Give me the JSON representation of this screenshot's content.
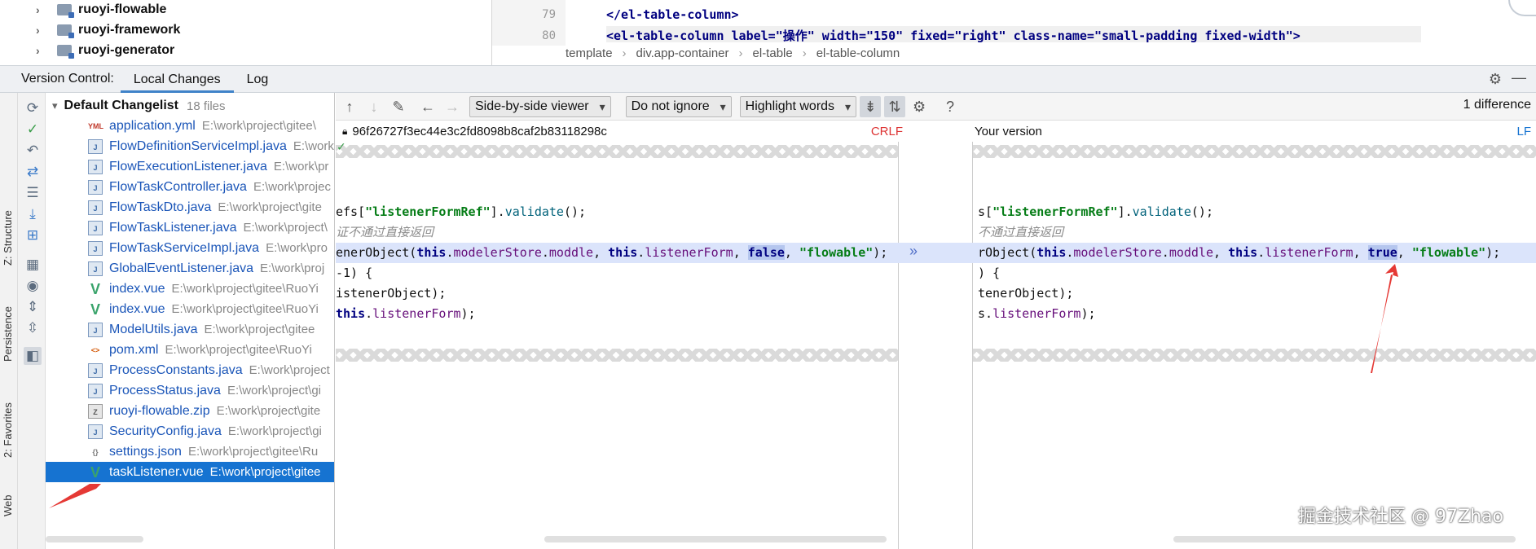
{
  "project_tree": {
    "items": [
      "ruoyi-flowable",
      "ruoyi-framework",
      "ruoyi-generator"
    ]
  },
  "top_editor": {
    "line_numbers": [
      "79",
      "80"
    ],
    "line79": "</el-table-column>",
    "line80": "<el-table-column label=\"操作\" width=\"150\" fixed=\"right\" class-name=\"small-padding fixed-width\">",
    "breadcrumbs": [
      "template",
      "div.app-container",
      "el-table",
      "el-table-column"
    ]
  },
  "vc_bar": {
    "title": "Version Control:",
    "tabs": [
      "Local Changes",
      "Log"
    ]
  },
  "side_labels": [
    "Z: Structure",
    "Persistence",
    "2: Favorites",
    "Web"
  ],
  "changelist": {
    "name": "Default Changelist",
    "count": "18 files",
    "files": [
      {
        "name": "application.yml",
        "path": "E:\\work\\project\\gitee\\",
        "icon": "yml"
      },
      {
        "name": "FlowDefinitionServiceImpl.java",
        "path": "E:\\work\\",
        "icon": "java"
      },
      {
        "name": "FlowExecutionListener.java",
        "path": "E:\\work\\pr",
        "icon": "java"
      },
      {
        "name": "FlowTaskController.java",
        "path": "E:\\work\\projec",
        "icon": "java"
      },
      {
        "name": "FlowTaskDto.java",
        "path": "E:\\work\\project\\gite",
        "icon": "java"
      },
      {
        "name": "FlowTaskListener.java",
        "path": "E:\\work\\project\\",
        "icon": "java"
      },
      {
        "name": "FlowTaskServiceImpl.java",
        "path": "E:\\work\\pro",
        "icon": "java"
      },
      {
        "name": "GlobalEventListener.java",
        "path": "E:\\work\\proj",
        "icon": "java"
      },
      {
        "name": "index.vue",
        "path": "E:\\work\\project\\gitee\\RuoYi",
        "icon": "vue"
      },
      {
        "name": "index.vue",
        "path": "E:\\work\\project\\gitee\\RuoYi",
        "icon": "vue"
      },
      {
        "name": "ModelUtils.java",
        "path": "E:\\work\\project\\gitee",
        "icon": "java"
      },
      {
        "name": "pom.xml",
        "path": "E:\\work\\project\\gitee\\RuoYi",
        "icon": "xml"
      },
      {
        "name": "ProcessConstants.java",
        "path": "E:\\work\\project",
        "icon": "java"
      },
      {
        "name": "ProcessStatus.java",
        "path": "E:\\work\\project\\gi",
        "icon": "java"
      },
      {
        "name": "ruoyi-flowable.zip",
        "path": "E:\\work\\project\\gite",
        "icon": "zip"
      },
      {
        "name": "SecurityConfig.java",
        "path": "E:\\work\\project\\gi",
        "icon": "java"
      },
      {
        "name": "settings.json",
        "path": "E:\\work\\project\\gitee\\Ru",
        "icon": "json"
      },
      {
        "name": "taskListener.vue",
        "path": "E:\\work\\project\\gitee",
        "icon": "vue",
        "selected": true
      }
    ]
  },
  "diff_toolbar": {
    "viewer": "Side-by-side viewer",
    "ignore": "Do not ignore",
    "highlight": "Highlight words",
    "help": "?",
    "count": "1 difference"
  },
  "left_pane": {
    "revision": "96f26727f3ec44e3c2fd8098b8caf2b83118298c",
    "line_sep": "CRLF",
    "lines": {
      "l1a": "efs[",
      "l1b": "\"listenerFormRef\"",
      "l1c": "].",
      "l1d": "validate",
      "l1e": "();",
      "l2": "证不通过直接返回",
      "l3a": "enerObject(",
      "l3b": "this",
      "l3c": ".",
      "l3d": "modelerStore",
      "l3e": ".",
      "l3f": "moddle",
      "l3g": ", ",
      "l3h": "this",
      "l3i": ".",
      "l3j": "listenerForm",
      "l3k": ", ",
      "l3l": "false",
      "l3m": ", ",
      "l3n": "\"flowable\"",
      "l3o": ");",
      "l4": "-1) {",
      "l5": "istenerObject);",
      "l6a": "this",
      "l6b": ".",
      "l6c": "listenerForm",
      "l6d": ");"
    }
  },
  "right_pane": {
    "title": "Your version",
    "line_sep": "LF",
    "lines": {
      "l1a": "s[",
      "l1b": "\"listenerFormRef\"",
      "l1c": "].",
      "l1d": "validate",
      "l1e": "();",
      "l2": "不通过直接返回",
      "l3a": "rObject(",
      "l3b": "this",
      "l3c": ".",
      "l3d": "modelerStore",
      "l3e": ".",
      "l3f": "moddle",
      "l3g": ", ",
      "l3h": "this",
      "l3i": ".",
      "l3j": "listenerForm",
      "l3k": ", ",
      "l3l": "true",
      "l3m": ", ",
      "l3n": "\"flowable\"",
      "l3o": ");",
      "l4": ") {",
      "l5": "tenerObject);",
      "l6a": "s",
      "l6b": ".",
      "l6c": "listenerForm",
      "l6d": ");"
    }
  },
  "watermark": "掘金技术社区 @ 97Zhao",
  "colors": {
    "accent": "#1673d1",
    "arrow": "#e53935",
    "changed_line": "#dbe4fb"
  }
}
